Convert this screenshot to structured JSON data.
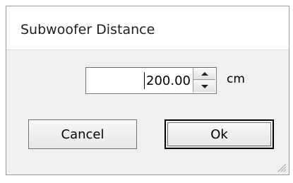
{
  "dialog": {
    "title": "Subwoofer Distance",
    "distance_value": "200.00",
    "unit": "cm",
    "cancel_label": "Cancel",
    "ok_label": "Ok"
  },
  "icons": {
    "spin_up": "chevron-up-icon",
    "spin_down": "chevron-down-icon",
    "resize_grip": "resize-grip-icon"
  }
}
